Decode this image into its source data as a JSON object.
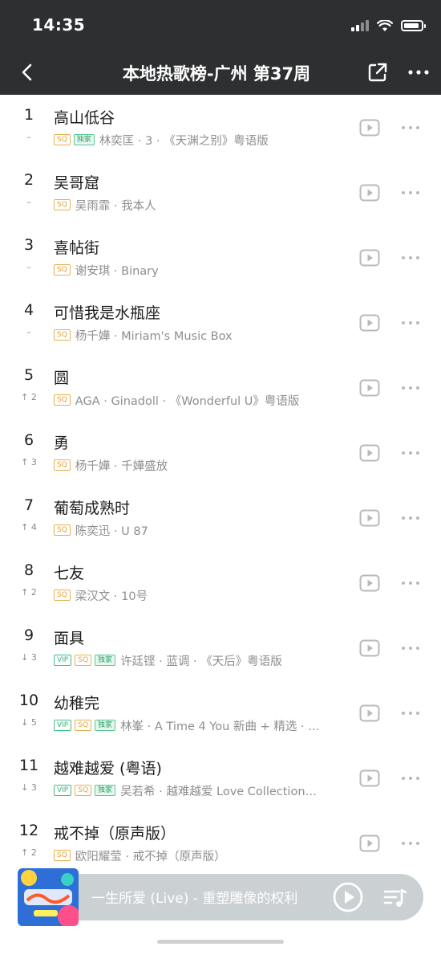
{
  "status_bar": {
    "time": "14:35"
  },
  "header": {
    "title": "本地热歌榜-广州 第37周"
  },
  "songs": [
    {
      "rank": "1",
      "trend": "–",
      "title": "高山低谷",
      "tags": [
        "SQ",
        "独家"
      ],
      "meta": "林奕匡 · 3 · 《天渊之别》粤语版"
    },
    {
      "rank": "2",
      "trend": "–",
      "title": "吴哥窟",
      "tags": [
        "SQ"
      ],
      "meta": "吴雨霏 · 我本人"
    },
    {
      "rank": "3",
      "trend": "–",
      "title": "喜帖街",
      "tags": [
        "SQ"
      ],
      "meta": "谢安琪 · Binary"
    },
    {
      "rank": "4",
      "trend": "–",
      "title": "可惜我是水瓶座",
      "tags": [
        "SQ"
      ],
      "meta": "杨千嬅 · Miriam's Music Box"
    },
    {
      "rank": "5",
      "trend": "↑ 2",
      "title": "圆",
      "tags": [
        "SQ"
      ],
      "meta": "AGA · Ginadoll · 《Wonderful U》粤语版"
    },
    {
      "rank": "6",
      "trend": "↑ 3",
      "title": "勇",
      "tags": [
        "SQ"
      ],
      "meta": "杨千嬅 · 千嬅盛放"
    },
    {
      "rank": "7",
      "trend": "↑ 4",
      "title": "葡萄成熟时",
      "tags": [
        "SQ"
      ],
      "meta": "陈奕迅 · U 87"
    },
    {
      "rank": "8",
      "trend": "↑ 2",
      "title": "七友",
      "tags": [
        "SQ"
      ],
      "meta": "梁汉文 · 10号"
    },
    {
      "rank": "9",
      "trend": "↓ 3",
      "title": "面具",
      "tags": [
        "VIP",
        "SQ",
        "独家"
      ],
      "meta": "许廷铿 · 蓝调 · 《天后》粤语版"
    },
    {
      "rank": "10",
      "trend": "↓ 5",
      "title": "幼稚完",
      "tags": [
        "VIP",
        "SQ",
        "独家"
      ],
      "meta": "林峯 · A Time 4 You 新曲 + 精选 · …"
    },
    {
      "rank": "11",
      "trend": "↓ 3",
      "title": "越难越爱 (粤语)",
      "tags": [
        "VIP",
        "SQ",
        "独家"
      ],
      "meta": "吴若希 · 越难越爱 Love Collection…"
    },
    {
      "rank": "12",
      "trend": "↑ 2",
      "title": "戒不掉（原声版）",
      "tags": [
        "SQ"
      ],
      "meta": "欧阳耀莹 · 戒不掉（原声版）"
    }
  ],
  "player": {
    "now_playing": "一生所爱 (Live) - 重塑雕像的权利"
  },
  "colors": {
    "header_bg": "#2e2f31",
    "sq_tag": "#e0a23b",
    "vip_tag": "#34b27b",
    "player_bg": "#c9ced2"
  },
  "icons": [
    "back-icon",
    "share-icon",
    "more-icon",
    "play-icon",
    "queue-icon",
    "wifi-icon",
    "signal-icon",
    "battery-icon"
  ]
}
